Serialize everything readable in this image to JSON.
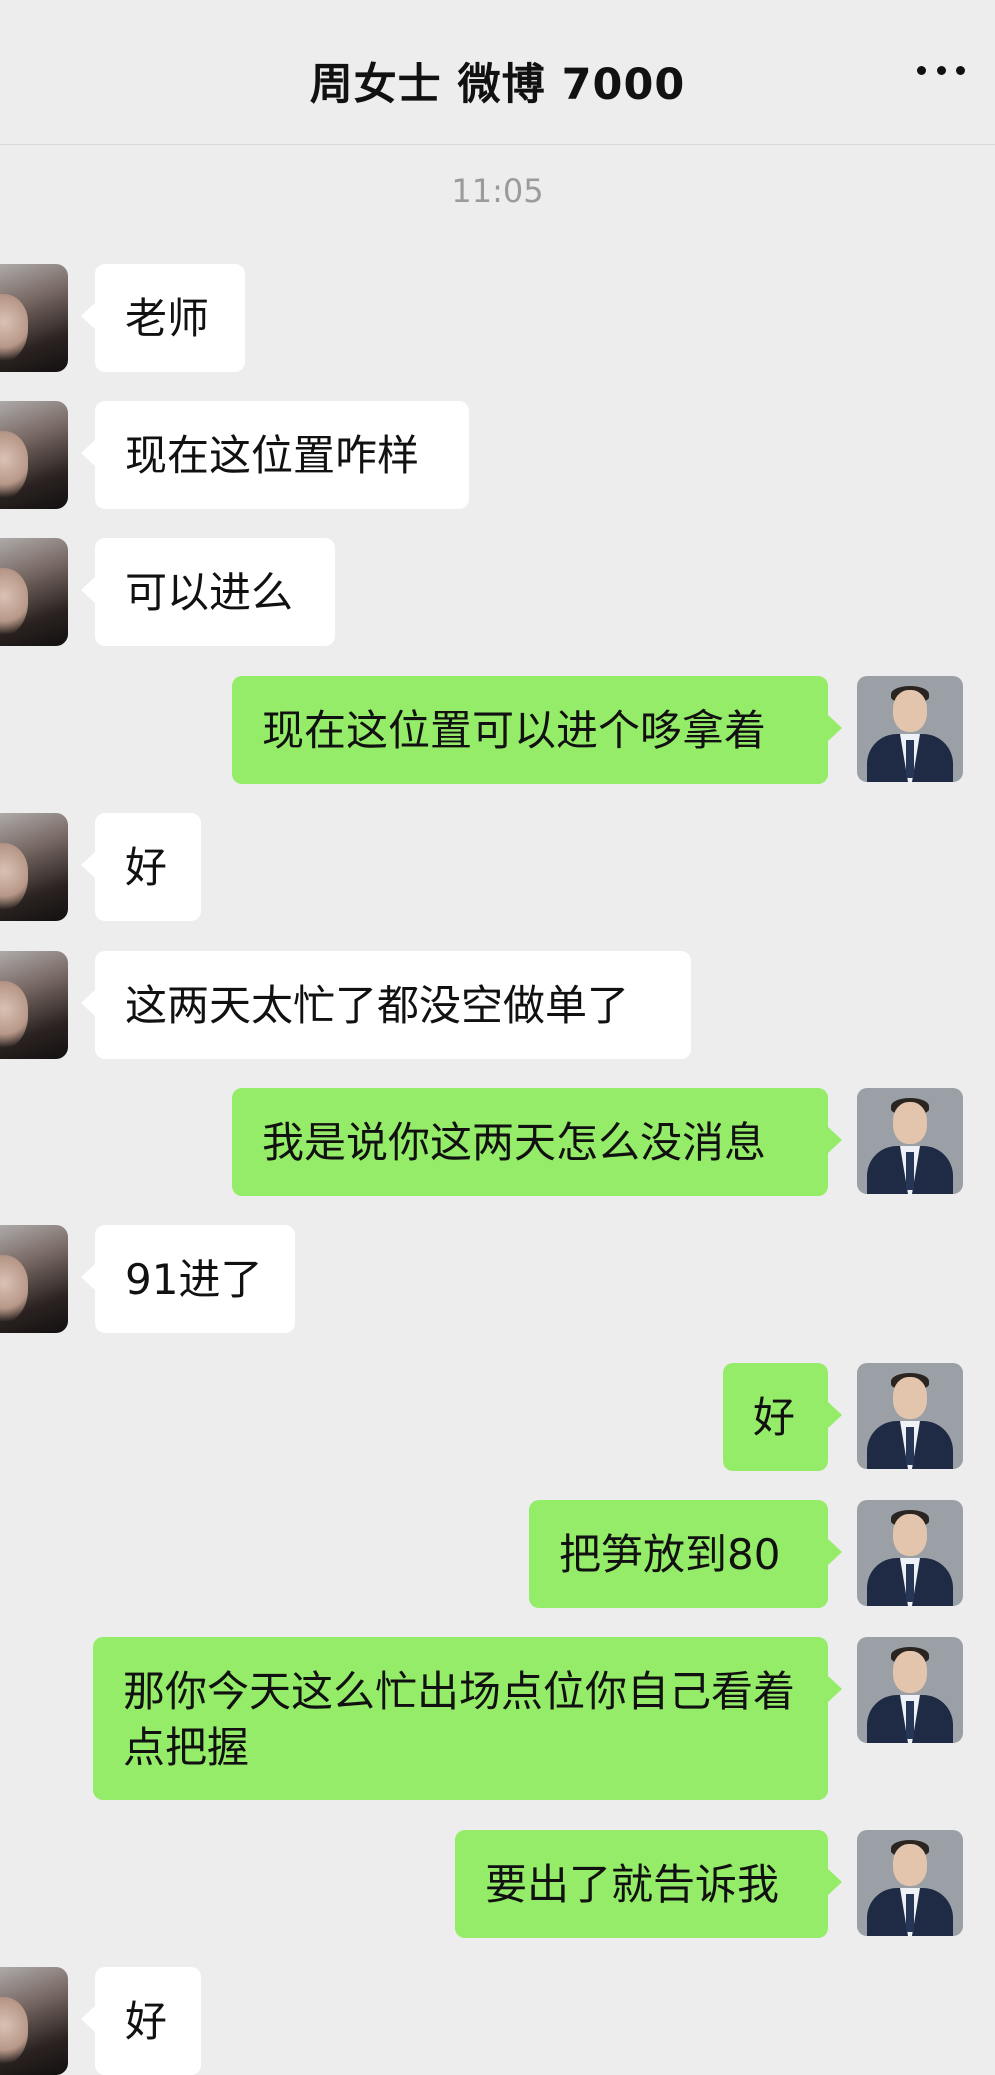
{
  "header": {
    "title": "周女士 微博 7000",
    "more_icon": "more-dots-icon"
  },
  "timestamp": "11:05",
  "messages": [
    {
      "side": "left",
      "text": "老师"
    },
    {
      "side": "left",
      "text": "现在这位置咋样"
    },
    {
      "side": "left",
      "text": "可以进么"
    },
    {
      "side": "right",
      "text": "现在这位置可以进个哆拿着"
    },
    {
      "side": "left",
      "text": "好"
    },
    {
      "side": "left",
      "text": "这两天太忙了都没空做单了"
    },
    {
      "side": "right",
      "text": "我是说你这两天怎么没消息"
    },
    {
      "side": "left",
      "text": "91进了"
    },
    {
      "side": "right",
      "text": "好"
    },
    {
      "side": "right",
      "text": "把笋放到80"
    },
    {
      "side": "right",
      "text": "那你今天这么忙出场点位你自己看着点把握"
    },
    {
      "side": "right",
      "text": "要出了就告诉我"
    },
    {
      "side": "left",
      "text": "好"
    }
  ],
  "colors": {
    "background": "#ededed",
    "incoming_bubble": "#ffffff",
    "outgoing_bubble": "#95ec69"
  }
}
